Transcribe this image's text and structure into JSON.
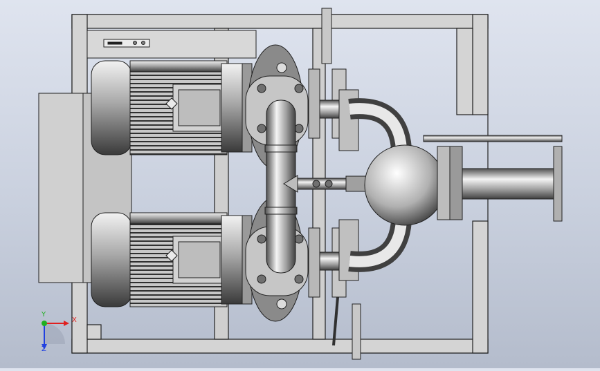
{
  "viewport": {
    "background_top": "#dfe4ef",
    "background_bottom": "#b4bccc",
    "model_fill": "#cfcfcf",
    "model_stroke": "#202020"
  },
  "triad": {
    "x_label": "X",
    "y_label": "Y",
    "z_label": "Z",
    "x_color": "#e02020",
    "y_color": "#20b020",
    "z_color": "#2040e0"
  }
}
